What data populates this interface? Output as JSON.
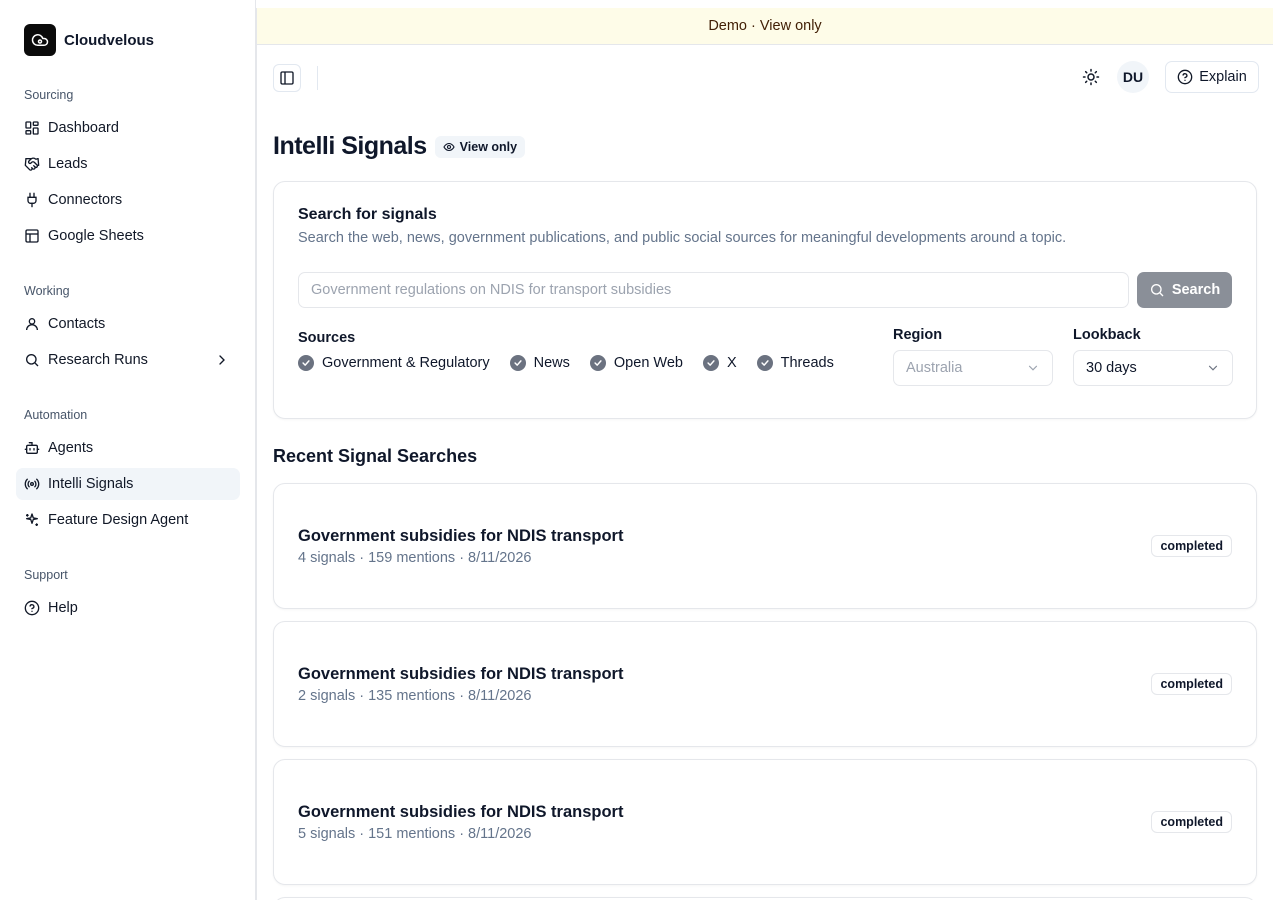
{
  "brand": {
    "name": "Cloudvelous",
    "logo_icon": "cloud-icon"
  },
  "sidebar": {
    "sections": [
      {
        "label": "Sourcing"
      },
      {
        "label": "Working"
      },
      {
        "label": "Automation"
      },
      {
        "label": "Support"
      }
    ],
    "items": [
      {
        "label": "Dashboard",
        "icon": "dashboard-icon"
      },
      {
        "label": "Leads",
        "icon": "handshake-icon"
      },
      {
        "label": "Connectors",
        "icon": "plug-icon"
      },
      {
        "label": "Google Sheets",
        "icon": "table-icon"
      },
      {
        "label": "Contacts",
        "icon": "user-icon"
      },
      {
        "label": "Research Runs",
        "icon": "search-icon"
      },
      {
        "label": "Agents",
        "icon": "bot-icon"
      },
      {
        "label": "Intelli Signals",
        "icon": "radio-icon",
        "active": true
      },
      {
        "label": "Feature Design Agent",
        "icon": "sparkles-icon"
      },
      {
        "label": "Help",
        "icon": "help-circle-icon"
      }
    ]
  },
  "banner": {
    "text": "Demo · View only",
    "color": "#fefce8"
  },
  "topbar": {
    "avatar_initials": "DU",
    "explain_label": "Explain"
  },
  "page": {
    "title": "Intelli Signals",
    "badge": "View only"
  },
  "search_card": {
    "title": "Search for signals",
    "description": "Search the web, news, government publications, and public social sources for meaningful developments around a topic.",
    "input_placeholder": "Government regulations on NDIS for transport subsidies",
    "input_value": "",
    "search_label": "Search",
    "sources_label": "Sources",
    "sources": [
      "Government & Regulatory",
      "News",
      "Open Web",
      "X",
      "Threads"
    ],
    "region_label": "Region",
    "region_value": "Australia",
    "lookback_label": "Lookback",
    "lookback_value": "30 days"
  },
  "recent": {
    "title": "Recent Signal Searches",
    "items": [
      {
        "title": "Government subsidies for NDIS transport",
        "meta": "4 signals · 159 mentions · 8/11/2026",
        "status": "completed"
      },
      {
        "title": "Government subsidies for NDIS transport",
        "meta": "2 signals · 135 mentions · 8/11/2026",
        "status": "completed"
      },
      {
        "title": "Government subsidies for NDIS transport",
        "meta": "5 signals · 151 mentions · 8/11/2026",
        "status": "completed"
      }
    ]
  }
}
